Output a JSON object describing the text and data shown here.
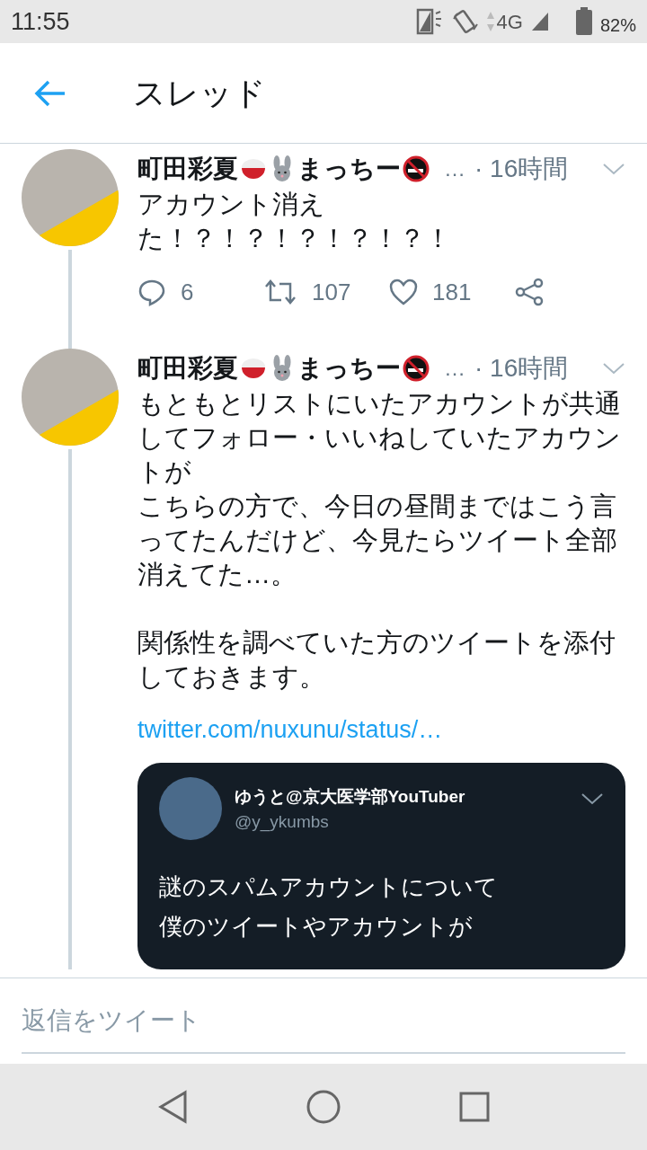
{
  "status_bar": {
    "time": "11:55",
    "network": "4G",
    "battery": "82%"
  },
  "header": {
    "title": "スレッド"
  },
  "tweets": [
    {
      "name": [
        "町田彩夏",
        "まっちー"
      ],
      "truncation": "…",
      "time": "· 16時間",
      "paragraphs": [
        [
          "アカウント消え",
          "た！？！？！？！？！？！"
        ]
      ],
      "actions": {
        "replies": "6",
        "retweets": "107",
        "likes": "181"
      }
    },
    {
      "name": [
        "町田彩夏",
        "まっちー"
      ],
      "truncation": "…",
      "time": "· 16時間",
      "paragraphs": [
        [
          "もともとリストにいたアカウントが共通してフォロー・いいねしていたアカウントが",
          "こちらの方で、今日の昼間まではこう言ってたんだけど、今見たらツイート全部消えてた…。"
        ],
        [
          "関係性を調べていた方のツイートを添付しておきます。"
        ]
      ],
      "link": "twitter.com/nuxunu/status/…",
      "quoted": {
        "name": "ゆうと@京大医学部YouTuber",
        "handle": "@y_ykumbs",
        "lines": [
          "謎のスパムアカウントについて",
          "僕のツイートやアカウントが"
        ]
      }
    }
  ],
  "reply_bar": {
    "placeholder": "返信をツイート"
  }
}
